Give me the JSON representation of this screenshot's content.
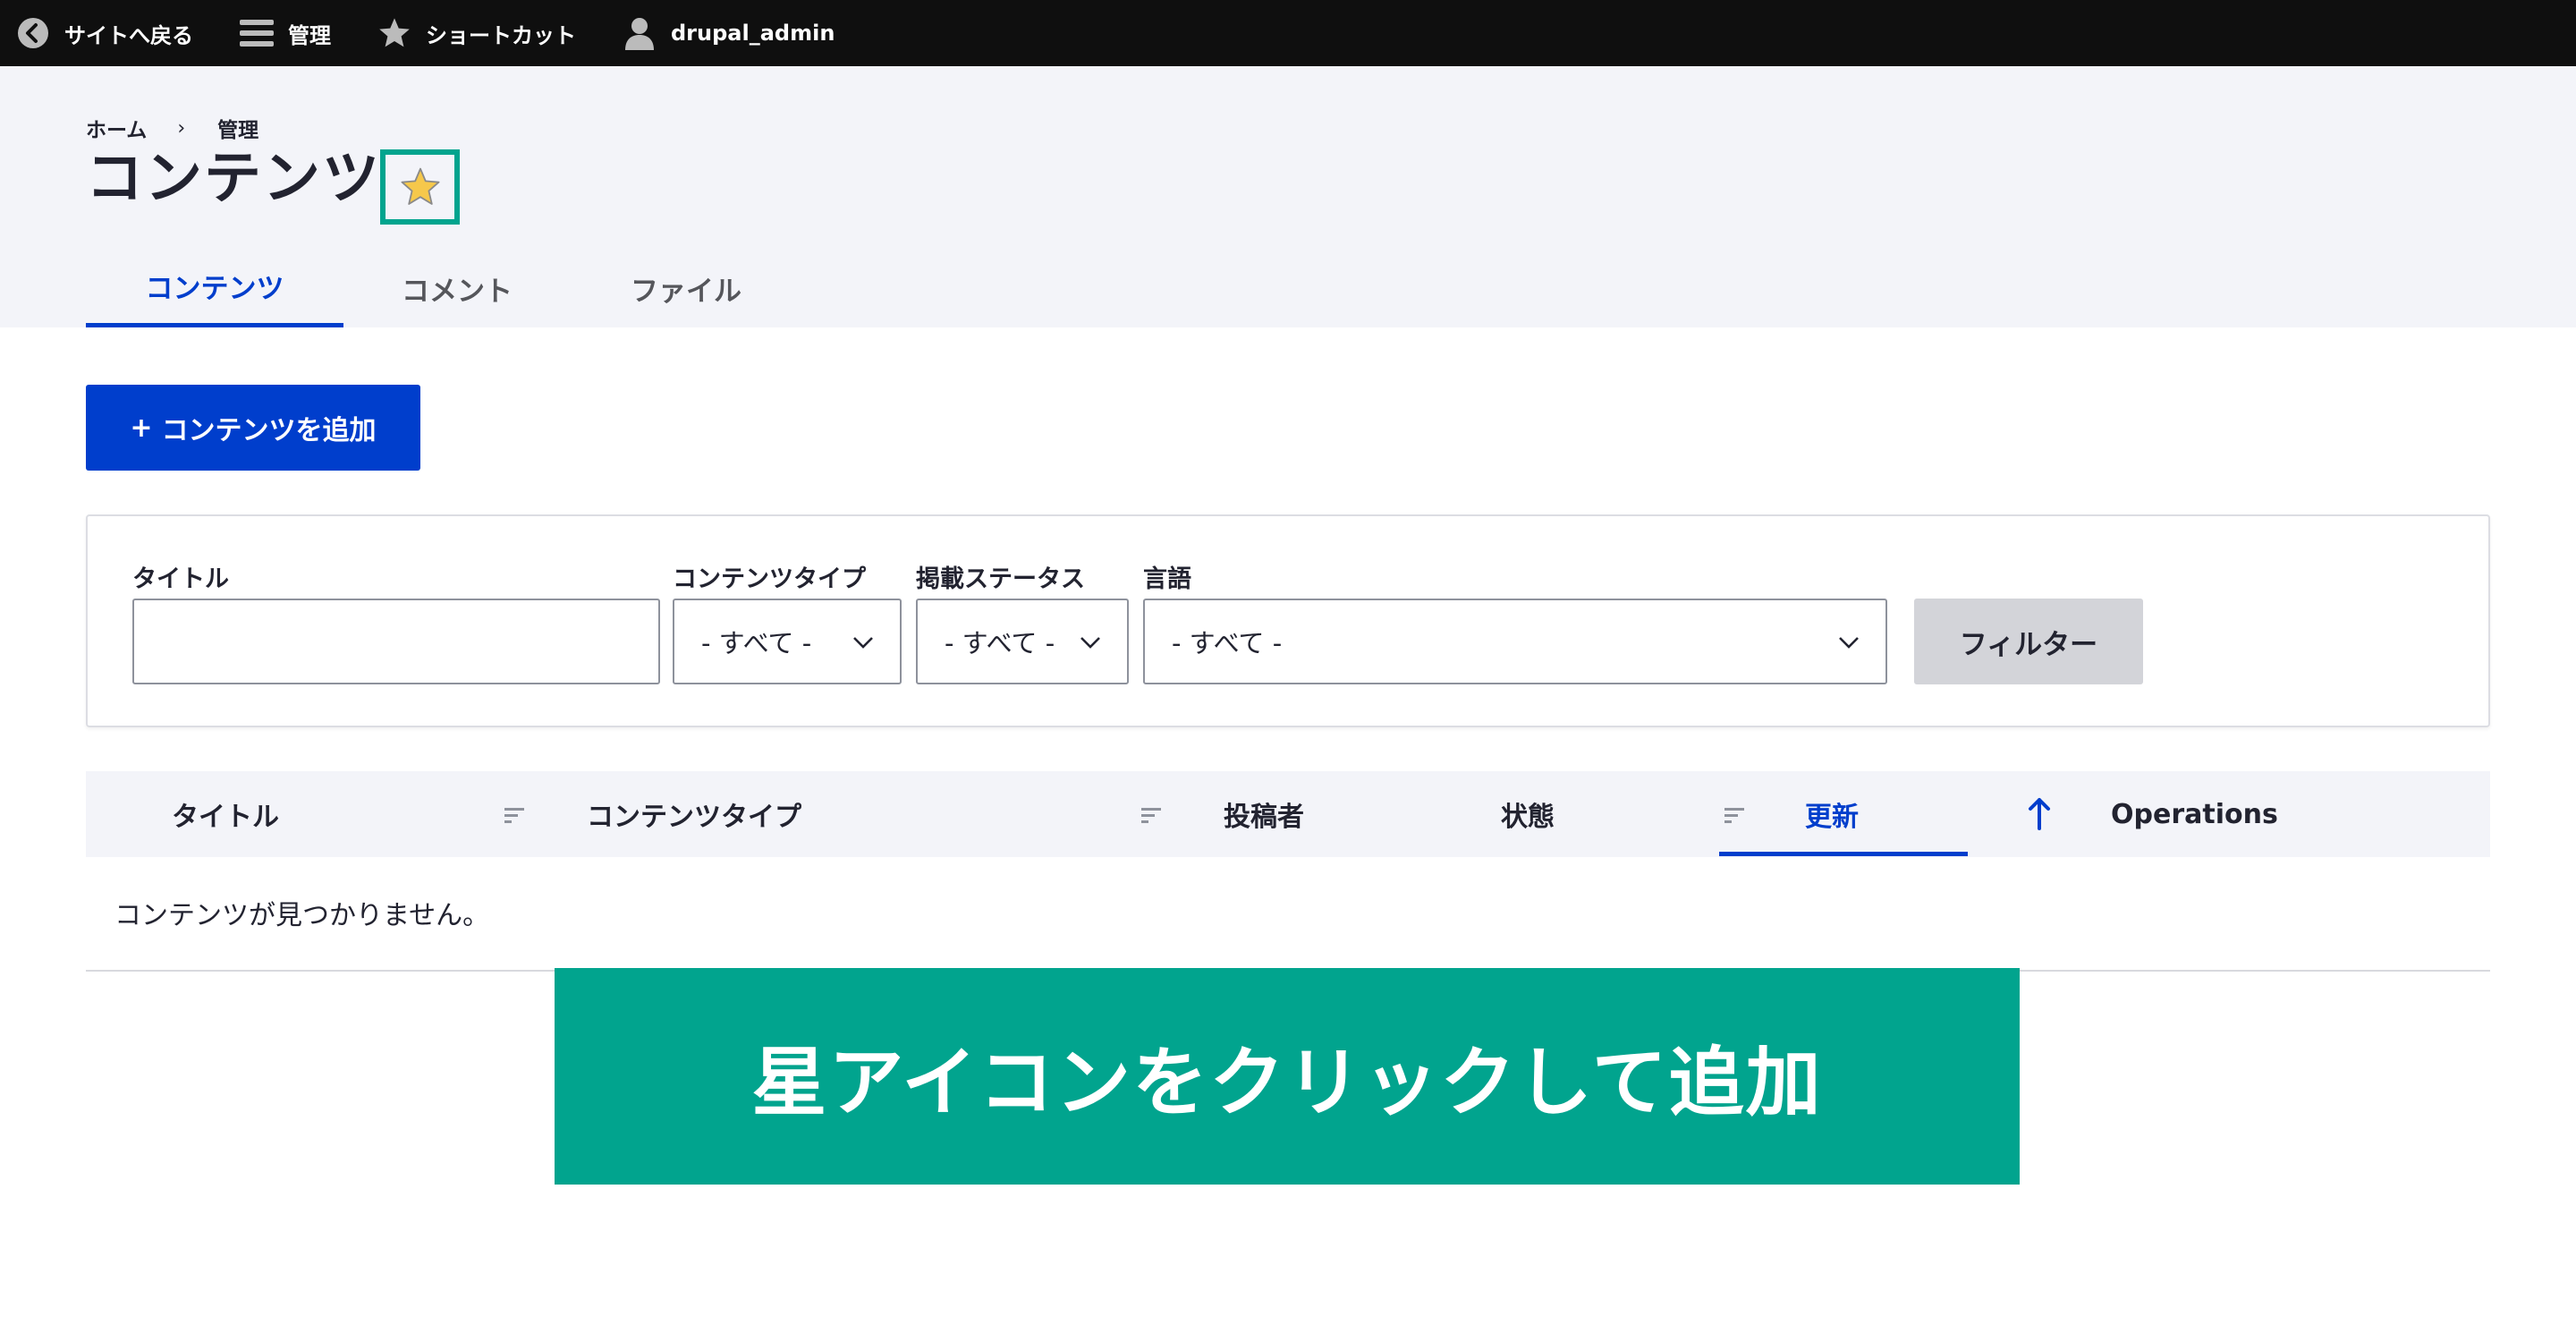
{
  "toolbar": {
    "back_label": "サイトへ戻る",
    "manage_label": "管理",
    "shortcut_label": "ショートカット",
    "user_label": "drupal_admin"
  },
  "breadcrumb": {
    "home": "ホーム",
    "separator": "›",
    "current": "管理"
  },
  "page": {
    "title": "コンテンツ"
  },
  "tabs": [
    {
      "label": "コンテンツ",
      "active": true
    },
    {
      "label": "コメント",
      "active": false
    },
    {
      "label": "ファイル",
      "active": false
    }
  ],
  "add_button": {
    "plus": "+",
    "label": "コンテンツを追加"
  },
  "filters": {
    "title_label": "タイトル",
    "title_value": "",
    "type_label": "コンテンツタイプ",
    "type_value": "- すべて -",
    "status_label": "掲載ステータス",
    "status_value": "- すべて -",
    "language_label": "言語",
    "language_value": "- すべて -",
    "filter_button": "フィルター"
  },
  "table": {
    "headers": [
      "タイトル",
      "コンテンツタイプ",
      "投稿者",
      "状態",
      "更新",
      "Operations"
    ],
    "sorted_column": "更新",
    "sort_direction": "ascending",
    "empty_message": "コンテンツが見つかりません。"
  },
  "callout": {
    "text": "星アイコンをクリックして追加"
  },
  "colors": {
    "accent": "#003ecc",
    "highlight": "#01a48e",
    "toolbar_bg": "#0f0f0f",
    "header_bg": "#f3f4f9"
  }
}
